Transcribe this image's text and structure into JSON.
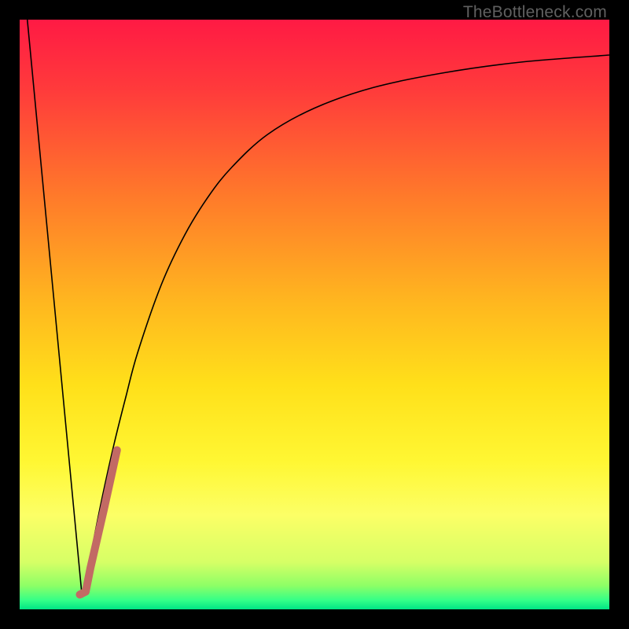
{
  "watermark": "TheBottleneck.com",
  "chart_data": {
    "type": "line",
    "title": "",
    "xlabel": "",
    "ylabel": "",
    "xlim": [
      0,
      100
    ],
    "ylim": [
      0,
      100
    ],
    "grid": false,
    "legend": false,
    "gradient_stops": [
      {
        "pos": 0.0,
        "color": "#ff1a44"
      },
      {
        "pos": 0.12,
        "color": "#ff3b3b"
      },
      {
        "pos": 0.3,
        "color": "#ff7a2a"
      },
      {
        "pos": 0.48,
        "color": "#ffb71f"
      },
      {
        "pos": 0.62,
        "color": "#ffe01a"
      },
      {
        "pos": 0.75,
        "color": "#fff733"
      },
      {
        "pos": 0.84,
        "color": "#fcff66"
      },
      {
        "pos": 0.92,
        "color": "#d6ff66"
      },
      {
        "pos": 0.96,
        "color": "#8dff66"
      },
      {
        "pos": 0.985,
        "color": "#33ff88"
      },
      {
        "pos": 1.0,
        "color": "#00e585"
      }
    ],
    "series": [
      {
        "name": "left-descent",
        "color": "#000000",
        "width": 1.6,
        "points": [
          {
            "x": 1.3,
            "y": 100.0
          },
          {
            "x": 10.6,
            "y": 2.0
          }
        ]
      },
      {
        "name": "right-ascent",
        "color": "#000000",
        "width": 1.6,
        "points": [
          {
            "x": 10.6,
            "y": 2.0
          },
          {
            "x": 12.0,
            "y": 9.0
          },
          {
            "x": 14.0,
            "y": 19.0
          },
          {
            "x": 16.0,
            "y": 28.0
          },
          {
            "x": 18.0,
            "y": 36.0
          },
          {
            "x": 20.0,
            "y": 43.5
          },
          {
            "x": 24.0,
            "y": 55.0
          },
          {
            "x": 28.0,
            "y": 63.5
          },
          {
            "x": 32.0,
            "y": 70.0
          },
          {
            "x": 36.0,
            "y": 75.0
          },
          {
            "x": 42.0,
            "y": 80.5
          },
          {
            "x": 50.0,
            "y": 85.0
          },
          {
            "x": 60.0,
            "y": 88.5
          },
          {
            "x": 72.0,
            "y": 91.0
          },
          {
            "x": 85.0,
            "y": 92.8
          },
          {
            "x": 100.0,
            "y": 94.0
          }
        ]
      }
    ],
    "highlight": {
      "name": "highlight-segment",
      "color": "#c26a64",
      "width": 10,
      "cap": "round",
      "points": [
        {
          "x": 10.2,
          "y": 2.5
        },
        {
          "x": 11.2,
          "y": 3.0
        },
        {
          "x": 12,
          "y": 7.0
        },
        {
          "x": 14.3,
          "y": 17.0
        },
        {
          "x": 16.5,
          "y": 27.0
        }
      ]
    }
  }
}
